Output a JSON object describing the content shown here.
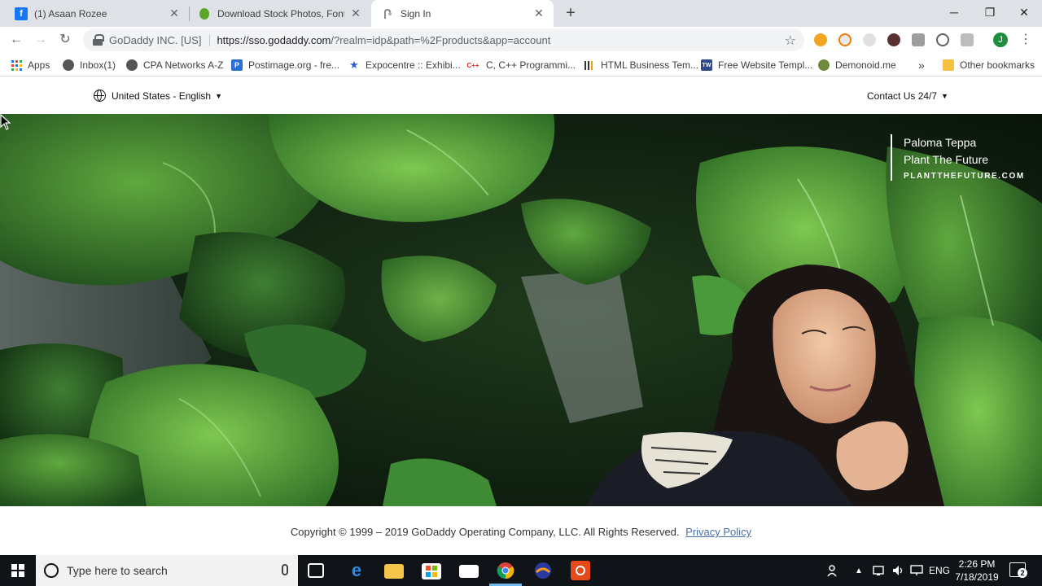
{
  "browser": {
    "tabs": [
      {
        "title": "(1) Asaan Rozee",
        "icon": "facebook-icon",
        "color": "#1877f2",
        "active": false
      },
      {
        "title": "Download Stock Photos, Fonts &",
        "icon": "leaf-icon",
        "color": "#5ba829",
        "active": false
      },
      {
        "title": "Sign In",
        "icon": "loading-icon",
        "color": "#8a8a8a",
        "active": true
      }
    ],
    "window_controls": {
      "minimize": "─",
      "restore": "❐",
      "close": "✕"
    }
  },
  "toolbar": {
    "back": "←",
    "forward": "→",
    "reload": "↻",
    "ev_label": "GoDaddy INC. [US]",
    "url_host": "https://sso.godaddy.com",
    "url_path": "/?realm=idp&path=%2Fproducts&app=account",
    "star": "☆",
    "profile_initial": "J",
    "menu": "⋮"
  },
  "bookmarks": {
    "items": [
      {
        "label": "Apps"
      },
      {
        "label": "Inbox(1)"
      },
      {
        "label": "CPA Networks A-Z"
      },
      {
        "label": "Postimage.org - fre..."
      },
      {
        "label": "Expocentre :: Exhibi..."
      },
      {
        "label": "C, C++ Programmi..."
      },
      {
        "label": "HTML Business Tem..."
      },
      {
        "label": "Free Website Templ..."
      },
      {
        "label": "Demonoid.me"
      }
    ],
    "overflow": "»",
    "other": "Other bookmarks",
    "c_icon_text": "C++",
    "tw_icon_text": "TW"
  },
  "page": {
    "locale": "United States - English",
    "contact": "Contact Us 24/7",
    "caret": "▼",
    "credit": {
      "name": "Paloma Teppa",
      "title": "Plant The Future",
      "url": "PLANTTHEFUTURE.COM"
    },
    "footer": {
      "copyright": "Copyright © 1999 – 2019 GoDaddy Operating Company, LLC. All Rights Reserved.",
      "privacy": "Privacy Policy"
    }
  },
  "taskbar": {
    "search_placeholder": "Type here to search",
    "language": "ENG",
    "time": "2:26 PM",
    "date": "7/18/2019",
    "notifications": "2"
  }
}
